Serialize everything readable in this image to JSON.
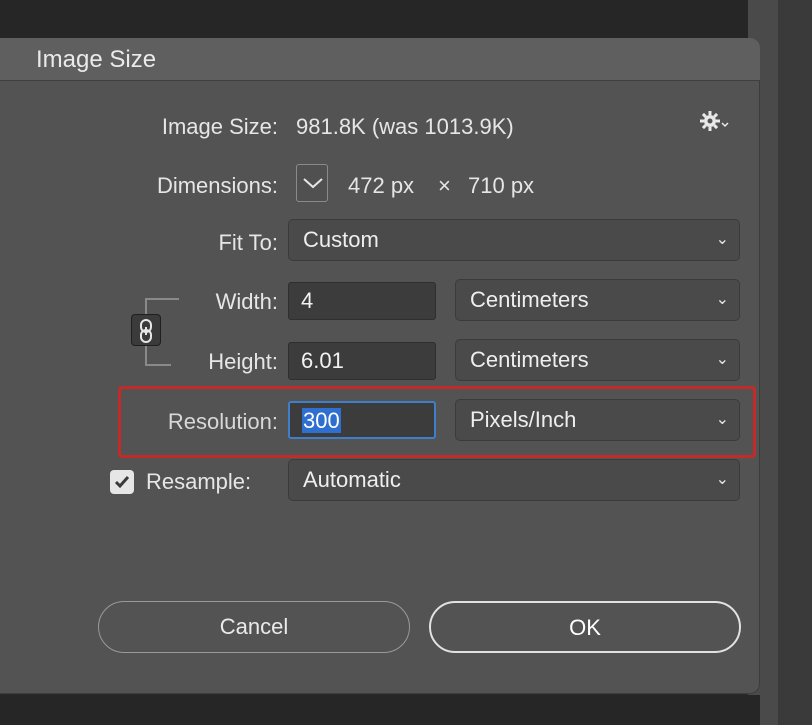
{
  "dialog": {
    "title": "Image Size",
    "image_size": {
      "label": "Image Size:",
      "value": "981.8K (was 1013.9K)"
    },
    "dimensions": {
      "label": "Dimensions:",
      "width": "472 px",
      "times": "×",
      "height": "710 px"
    },
    "fit_to": {
      "label": "Fit To:",
      "value": "Custom"
    },
    "width": {
      "label": "Width:",
      "value": "4",
      "unit": "Centimeters"
    },
    "height": {
      "label": "Height:",
      "value": "6.01",
      "unit": "Centimeters"
    },
    "resolution": {
      "label": "Resolution:",
      "value": "300",
      "unit": "Pixels/Inch"
    },
    "resample": {
      "label": "Resample:",
      "checked": true,
      "value": "Automatic"
    },
    "buttons": {
      "cancel": "Cancel",
      "ok": "OK"
    },
    "icons": {
      "settings": "gear-icon",
      "dimensions_toggle": "chevron-down-icon",
      "constrain": "link-icon",
      "checkbox": "checkmark-icon"
    },
    "colors": {
      "highlight_border": "#c32a2a",
      "focus_border": "#3e7ecb",
      "selection": "#2f6fd0"
    }
  }
}
